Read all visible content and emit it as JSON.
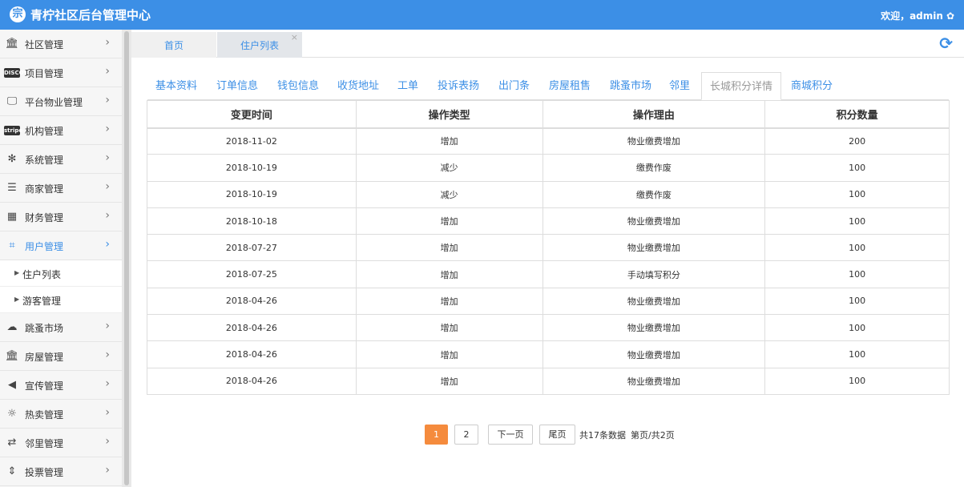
{
  "header": {
    "title": "青柠社区后台管理中心",
    "logo_glyph": "宗",
    "welcome": "欢迎，admin",
    "settings_icon": "gear-icon",
    "bg_color": "#3c8fe6"
  },
  "sidebar": {
    "items": [
      {
        "label": "社区管理",
        "icon": "bank-icon",
        "glyph": "🏛"
      },
      {
        "label": "项目管理",
        "icon": "discover-card-icon",
        "glyph": "DISCOVER"
      },
      {
        "label": "平台物业管理",
        "icon": "monitor-icon",
        "glyph": "🖵"
      },
      {
        "label": "机构管理",
        "icon": "stripe-icon",
        "glyph": "stripe"
      },
      {
        "label": "系统管理",
        "icon": "yelp-icon",
        "glyph": "✻"
      },
      {
        "label": "商家管理",
        "icon": "list-icon",
        "glyph": "☰"
      },
      {
        "label": "财务管理",
        "icon": "calculator-icon",
        "glyph": "▦"
      },
      {
        "label": "用户管理",
        "icon": "crop-icon",
        "glyph": "⌗",
        "active": true
      },
      {
        "label": "跳蚤市场",
        "icon": "cloud-icon",
        "glyph": "☁"
      },
      {
        "label": "房屋管理",
        "icon": "bank-icon",
        "glyph": "🏛"
      },
      {
        "label": "宣传管理",
        "icon": "volume-icon",
        "glyph": "◀"
      },
      {
        "label": "热卖管理",
        "icon": "sun-icon",
        "glyph": "☼"
      },
      {
        "label": "邻里管理",
        "icon": "retweet-icon",
        "glyph": "⇄"
      },
      {
        "label": "投票管理",
        "icon": "sort-icon",
        "glyph": "⇕"
      }
    ],
    "sub_items": [
      {
        "label": "住户列表"
      },
      {
        "label": "游客管理"
      }
    ]
  },
  "page_tabs": [
    {
      "label": "首页"
    },
    {
      "label": "住户列表",
      "close": "×"
    }
  ],
  "refresh_icon": "refresh-icon",
  "detail_tabs": [
    "基本资料",
    "订单信息",
    "钱包信息",
    "收货地址",
    "工单",
    "投诉表扬",
    "出门条",
    "房屋租售",
    "跳蚤市场",
    "邻里",
    "长城积分详情",
    "商城积分"
  ],
  "active_detail_tab": "长城积分详情",
  "table": {
    "columns": [
      "变更时间",
      "操作类型",
      "操作理由",
      "积分数量"
    ],
    "rows": [
      [
        "2018-11-02",
        "增加",
        "物业缴费增加",
        "200"
      ],
      [
        "2018-10-19",
        "减少",
        "缴费作废",
        "100"
      ],
      [
        "2018-10-19",
        "减少",
        "缴费作废",
        "100"
      ],
      [
        "2018-10-18",
        "增加",
        "物业缴费增加",
        "100"
      ],
      [
        "2018-07-27",
        "增加",
        "物业缴费增加",
        "100"
      ],
      [
        "2018-07-25",
        "增加",
        "手动填写积分",
        "100"
      ],
      [
        "2018-04-26",
        "增加",
        "物业缴费增加",
        "100"
      ],
      [
        "2018-04-26",
        "增加",
        "物业缴费增加",
        "100"
      ],
      [
        "2018-04-26",
        "增加",
        "物业缴费增加",
        "100"
      ],
      [
        "2018-04-26",
        "增加",
        "物业缴费增加",
        "100"
      ]
    ]
  },
  "pagination": {
    "pages": [
      "1",
      "2"
    ],
    "current": "1",
    "next": "下一页",
    "last": "尾页",
    "total": "共17条数据",
    "page_info": "第页/共2页",
    "accent": "#f58b3d"
  }
}
